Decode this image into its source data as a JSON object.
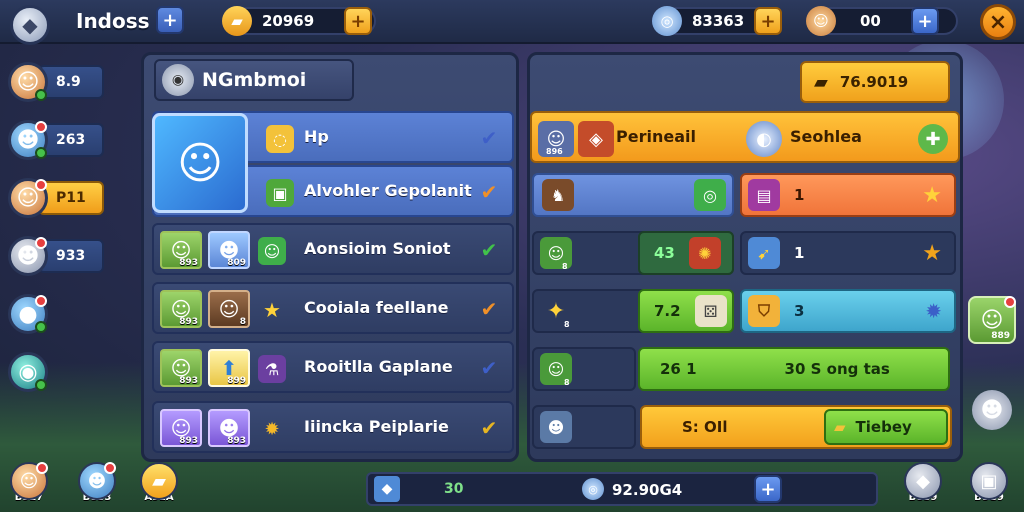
{
  "topbar": {
    "title": "Indoss",
    "add_label": "+",
    "gold_value": "20969",
    "gold_add": "+",
    "gems_value": "83363",
    "gems_add": "+",
    "energy_value": "00",
    "energy_add": "+",
    "close_label": "×"
  },
  "rail": [
    {
      "value": "8.9"
    },
    {
      "value": "263"
    },
    {
      "value": "P11",
      "active": true
    },
    {
      "value": "933"
    }
  ],
  "left_panel": {
    "title": "NGmbmoi",
    "rows": [
      {
        "label": "Hp",
        "numbers": []
      },
      {
        "label": "Alvohler Gepolanit",
        "numbers": []
      },
      {
        "label": "Aonsioim Soniot",
        "numbers": [
          "893",
          "809"
        ]
      },
      {
        "label": "Cooiala feellane",
        "numbers": [
          "893",
          "8"
        ]
      },
      {
        "label": "Rooitlla Gaplane",
        "numbers": [
          "893",
          "899"
        ]
      },
      {
        "label": "Iiincka Peiplarie",
        "numbers": [
          "893",
          "893"
        ]
      }
    ]
  },
  "right_panel": {
    "cta_value": "76.9019",
    "tabs": {
      "left": "Perineail",
      "left_avatar_num": "896",
      "right": "Seohlea"
    },
    "rows": [
      {
        "avatar_num": "",
        "c1": "",
        "c2": "1"
      },
      {
        "avatar_num": "8",
        "c1": "43",
        "c2": "1"
      },
      {
        "avatar_num": "8",
        "c1": "7.2",
        "c2": "3"
      },
      {
        "avatar_num": "8",
        "c1": "26  1",
        "c2": "30 S ong tas"
      },
      {
        "avatar_num": "",
        "c1": "S: OIl",
        "c2": "Tiebey"
      }
    ]
  },
  "bottom": {
    "left_value": "30",
    "right_value": "92.90G4",
    "plus": "+",
    "items": [
      {
        "label": "B927"
      },
      {
        "label": "B8S3"
      },
      {
        "label": "A9EA"
      }
    ],
    "right_items": [
      {
        "label": "B8S9"
      },
      {
        "label": "B8G9"
      }
    ],
    "side_chip_num": "889"
  }
}
